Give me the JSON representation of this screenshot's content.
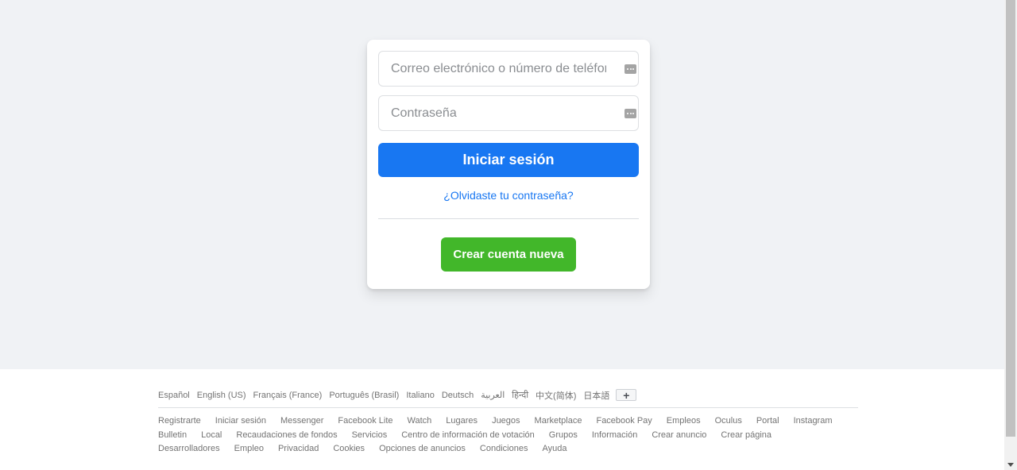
{
  "login": {
    "email_placeholder": "Correo electrónico o número de teléfono",
    "email_value": "",
    "password_placeholder": "Contraseña",
    "password_value": "",
    "login_button": "Iniciar sesión",
    "forgot_password": "¿Olvidaste tu contraseña?",
    "create_account_button": "Crear cuenta nueva",
    "password_manager_icon": "password-manager-icon"
  },
  "footer": {
    "languages": [
      "Español",
      "English (US)",
      "Français (France)",
      "Português (Brasil)",
      "Italiano",
      "Deutsch",
      "العربية",
      "हिन्दी",
      "中文(简体)",
      "日本語"
    ],
    "more_languages": "+",
    "links": [
      "Registrarte",
      "Iniciar sesión",
      "Messenger",
      "Facebook Lite",
      "Watch",
      "Lugares",
      "Juegos",
      "Marketplace",
      "Facebook Pay",
      "Empleos",
      "Oculus",
      "Portal",
      "Instagram",
      "Bulletin",
      "Local",
      "Recaudaciones de fondos",
      "Servicios",
      "Centro de información de votación",
      "Grupos",
      "Información",
      "Crear anuncio",
      "Crear página",
      "Desarrolladores",
      "Empleo",
      "Privacidad",
      "Cookies",
      "Opciones de anuncios",
      "Condiciones",
      "Ayuda"
    ]
  },
  "colors": {
    "page_background": "#f0f2f5",
    "primary_blue": "#1877f2",
    "create_green": "#42b72a",
    "footer_text": "#737373"
  }
}
